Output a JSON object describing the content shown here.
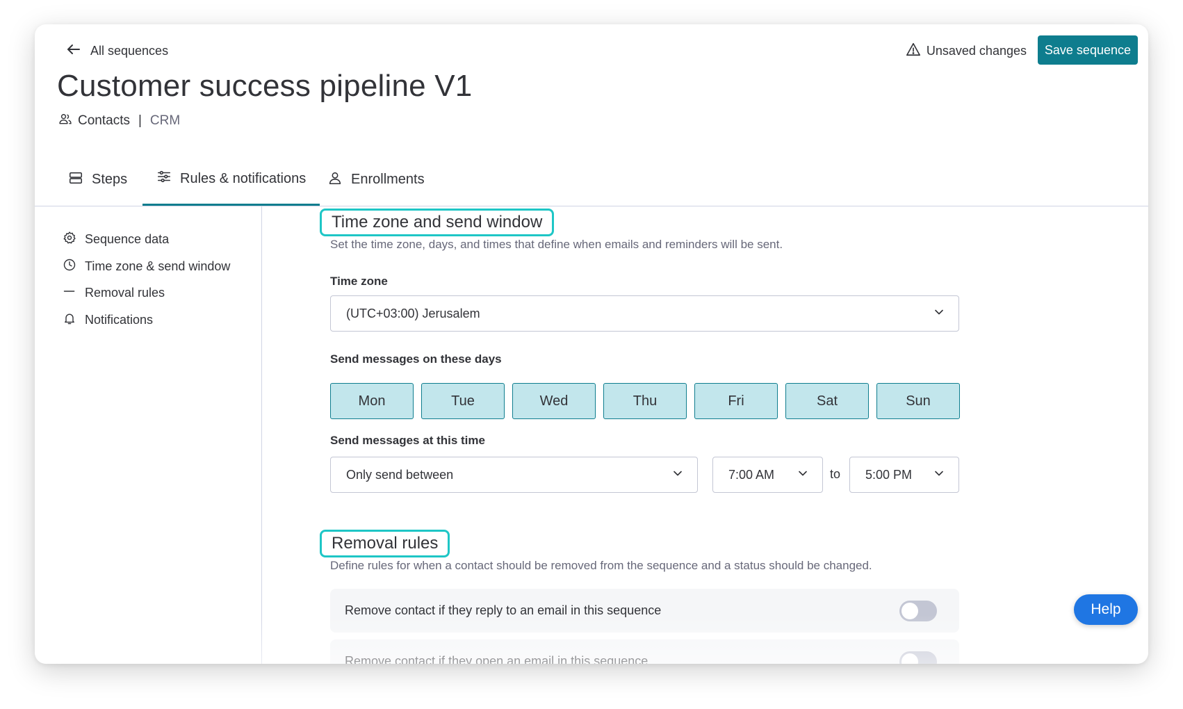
{
  "header": {
    "back_label": "All sequences",
    "unsaved_label": "Unsaved changes",
    "save_label": "Save sequence",
    "title": "Customer success pipeline V1",
    "board_name": "Contacts",
    "separator": "|",
    "workspace": "CRM"
  },
  "tabs": [
    {
      "label": "Steps",
      "icon": "steps-icon"
    },
    {
      "label": "Rules & notifications",
      "icon": "sliders-icon",
      "active": true
    },
    {
      "label": "Enrollments",
      "icon": "person-icon"
    }
  ],
  "sidebar": {
    "items": [
      {
        "label": "Sequence data",
        "icon": "gear-icon"
      },
      {
        "label": "Time zone & send window",
        "icon": "clock-icon"
      },
      {
        "label": "Removal rules",
        "icon": "dash-icon"
      },
      {
        "label": "Notifications",
        "icon": "bell-icon"
      }
    ]
  },
  "time_section": {
    "title": "Time zone and send window",
    "description": "Set the time zone, days, and times that define when emails and reminders will be sent.",
    "timezone_label": "Time zone",
    "timezone_value": "(UTC+03:00) Jerusalem",
    "days_label": "Send messages on these days",
    "days": [
      "Mon",
      "Tue",
      "Wed",
      "Thu",
      "Fri",
      "Sat",
      "Sun"
    ],
    "time_label": "Send messages at this time",
    "send_mode": "Only send between",
    "start_time": "7:00 AM",
    "to_label": "to",
    "end_time": "5:00 PM"
  },
  "removal_section": {
    "title": "Removal rules",
    "description": "Define rules for when a contact should be removed from the sequence and a status should be changed.",
    "rules": [
      {
        "label": "Remove contact if they reply to an email in this sequence",
        "enabled": false
      },
      {
        "label": "Remove contact if they open an email in this sequence",
        "enabled": false
      }
    ]
  },
  "help_label": "Help",
  "colors": {
    "accent": "#0e7d8e",
    "highlight": "#1ec6c6",
    "day_selected": "#c2e6ec",
    "help": "#1f76e3"
  }
}
